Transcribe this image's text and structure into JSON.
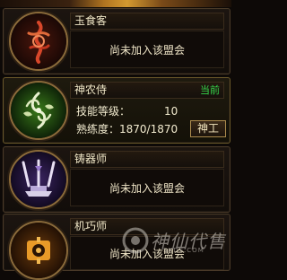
{
  "guilds": [
    {
      "name": "玉食客",
      "status": "尚未加入该盟会"
    },
    {
      "name": "神农侍",
      "current_label": "当前",
      "skill_level_label": "技能等级：",
      "skill_level_value": "10",
      "proficiency_label": "熟练度：",
      "proficiency_value": "1870/1870",
      "action_button": "神工"
    },
    {
      "name": "铸器师",
      "status": "尚未加入该盟会"
    },
    {
      "name": "机巧师",
      "status": "尚未加入该盟会"
    }
  ],
  "watermark": {
    "text": "神仙代售",
    "url": "SXDS.COM"
  },
  "colors": {
    "current_badge": "#35d54a",
    "text_primary": "#f1e8c8",
    "panel_border": "#4a3a28",
    "yushike_emblem": "#c0351e",
    "shennong_emblem": "#3a8a22",
    "zhuqi_emblem": "#6a3fb0",
    "jiqiao_emblem": "#e08a18"
  },
  "icons": [
    "flame-knot-icon",
    "leaf-swirl-icon",
    "forge-weapons-icon",
    "gear-box-icon"
  ]
}
